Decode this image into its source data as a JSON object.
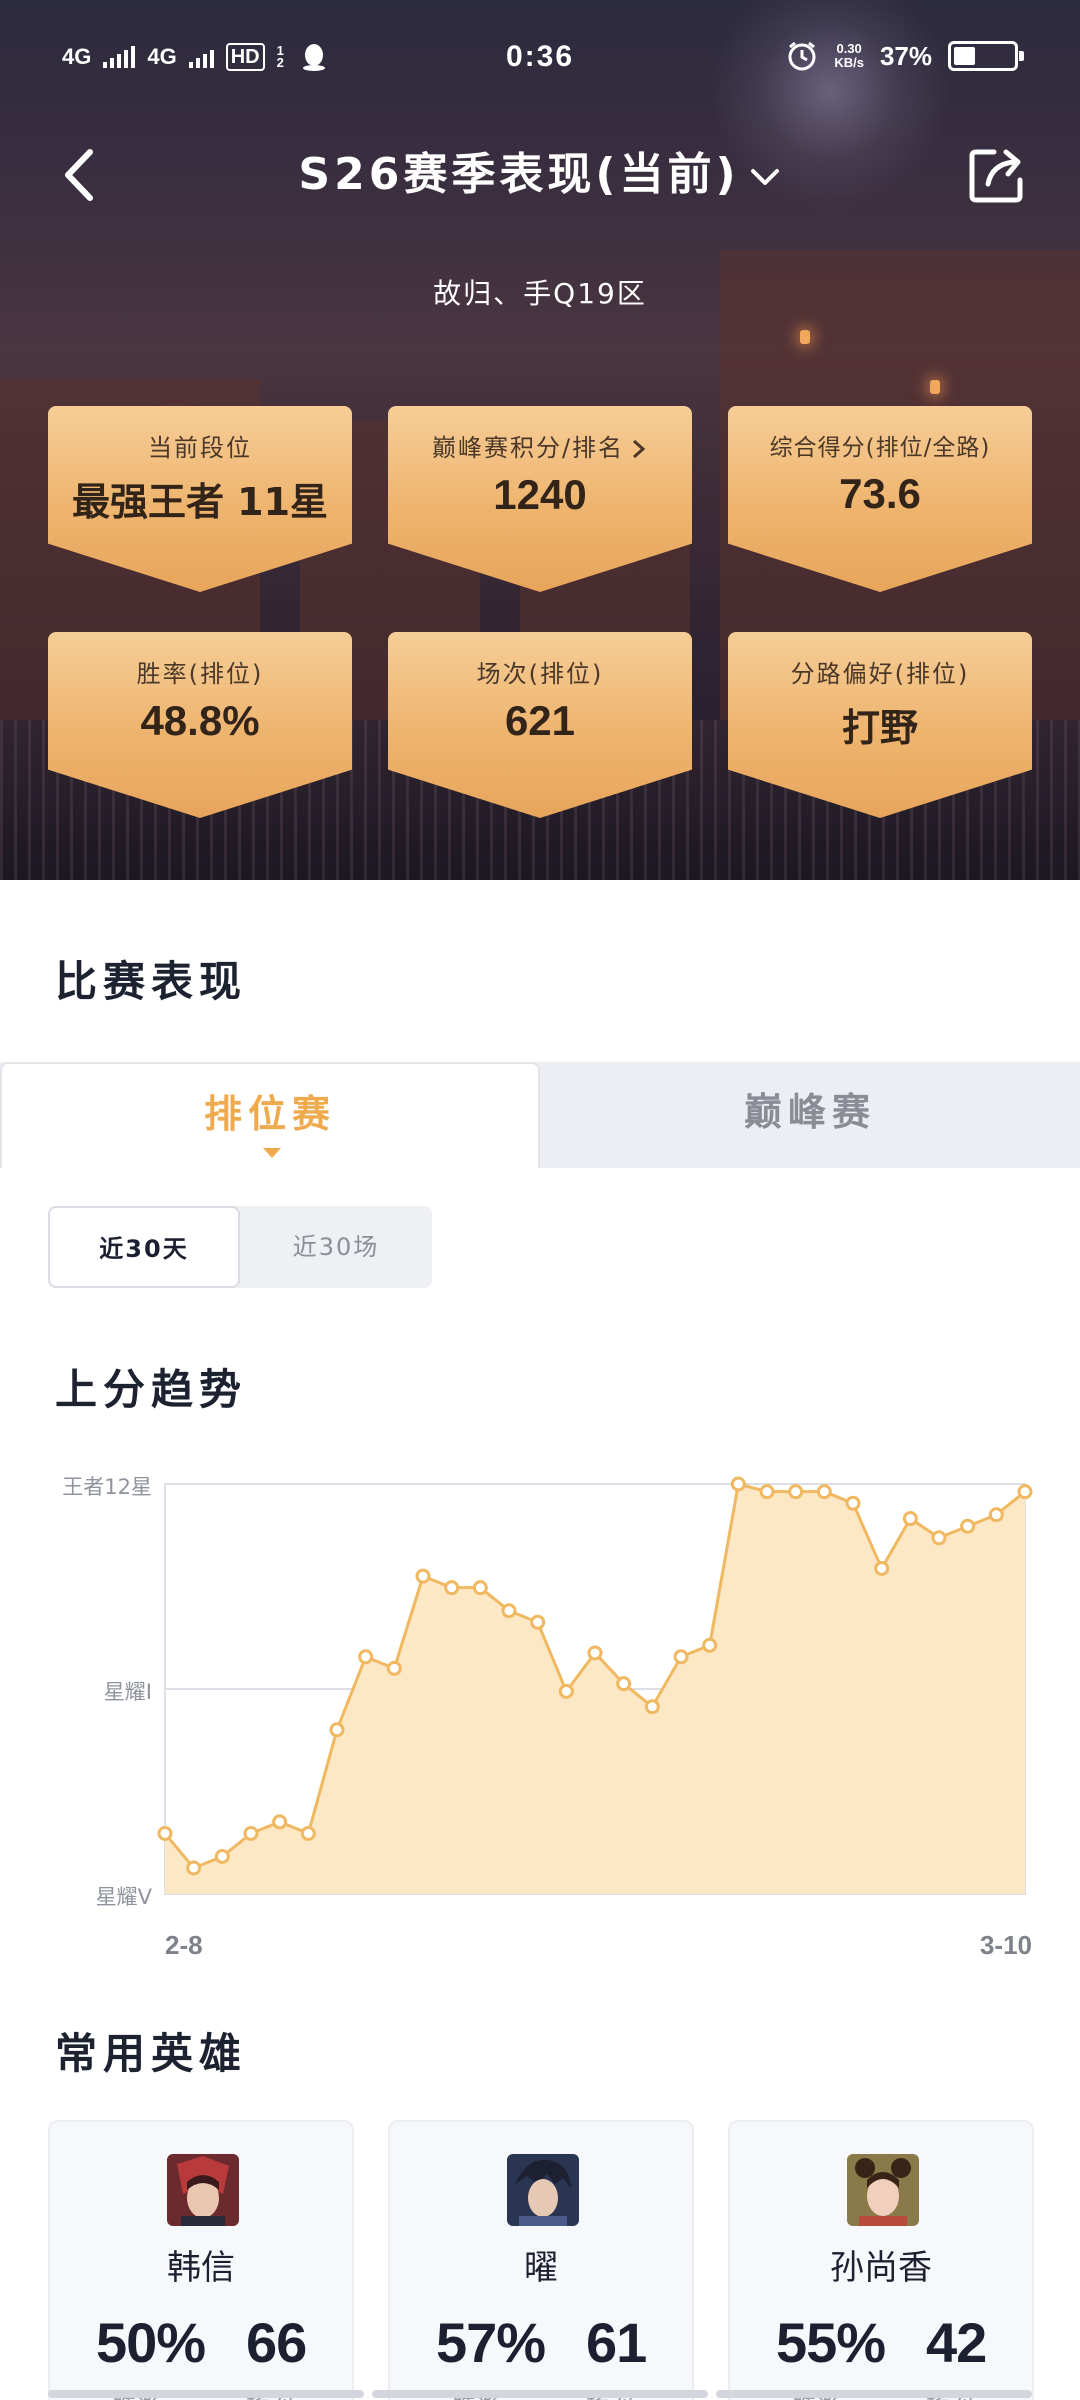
{
  "status_bar": {
    "network1": "4G",
    "network2": "4G",
    "hd": "HD",
    "sim_label": "1 2",
    "time": "0:36",
    "speed_value": "0.30",
    "speed_unit": "KB/s",
    "battery": "37%",
    "battery_level": 0.37
  },
  "header": {
    "title": "S26赛季表现(当前)",
    "account": "故归、手Q19区"
  },
  "stats": [
    {
      "label": "当前段位",
      "value": "最强王者 11星"
    },
    {
      "label": "巅峰赛积分/排名",
      "value": "1240"
    },
    {
      "label": "综合得分(排位/全路)",
      "value": "73.6"
    },
    {
      "label": "胜率(排位)",
      "value": "48.8%"
    },
    {
      "label": "场次(排位)",
      "value": "621"
    },
    {
      "label": "分路偏好(排位)",
      "value": "打野"
    }
  ],
  "match_section": {
    "title": "比赛表现"
  },
  "tabs": [
    {
      "label": "排位赛",
      "active": true
    },
    {
      "label": "巅峰赛",
      "active": false
    }
  ],
  "segment": [
    {
      "label": "近30天",
      "active": true
    },
    {
      "label": "近30场",
      "active": false
    }
  ],
  "trend_section": {
    "title": "上分趋势"
  },
  "chart_data": {
    "type": "area",
    "y_labels": [
      "王者12星",
      "星耀I",
      "星耀V"
    ],
    "x_start_label": "2-8",
    "x_end_label": "3-10",
    "ylim": [
      0,
      10
    ],
    "x": [
      1,
      2,
      3,
      4,
      5,
      6,
      7,
      8,
      9,
      10,
      11,
      12,
      13,
      14,
      15,
      16,
      17,
      18,
      19,
      20,
      21,
      22,
      23,
      24,
      25,
      26,
      27,
      28,
      29,
      30,
      31
    ],
    "values": [
      0.9,
      0.0,
      0.3,
      0.9,
      1.2,
      0.9,
      3.6,
      5.5,
      5.2,
      7.6,
      7.3,
      7.3,
      6.7,
      6.4,
      4.6,
      5.6,
      4.8,
      4.2,
      5.5,
      5.8,
      10.0,
      9.8,
      9.8,
      9.8,
      9.5,
      7.8,
      9.1,
      8.6,
      8.9,
      9.2,
      9.8
    ],
    "color": "#f0b860",
    "fill": "#fde8c6",
    "grid": true
  },
  "heroes_section": {
    "title": "常用英雄"
  },
  "heroes": [
    {
      "name": "韩信",
      "win_rate": "50%",
      "games": "66",
      "win_label": "胜率",
      "games_label": "场次"
    },
    {
      "name": "曜",
      "win_rate": "57%",
      "games": "61",
      "win_label": "胜率",
      "games_label": "场次"
    },
    {
      "name": "孙尚香",
      "win_rate": "55%",
      "games": "42",
      "win_label": "胜率",
      "games_label": "场次"
    }
  ]
}
